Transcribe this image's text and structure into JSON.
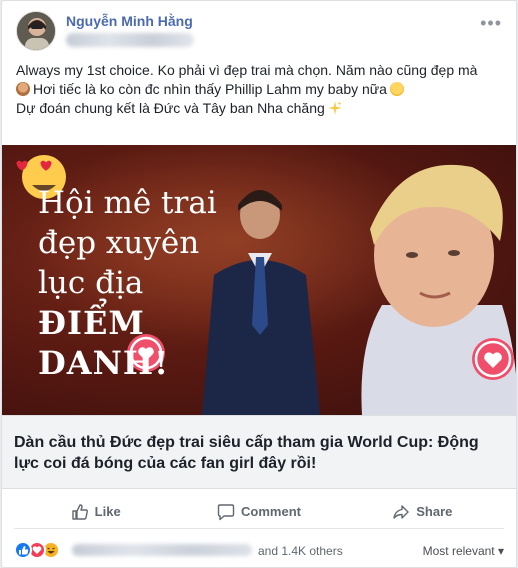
{
  "post": {
    "author": "Nguyễn Minh Hằng",
    "more_label": "•••",
    "lines": [
      "Always my 1st choice. Ko phải vì đẹp trai mà chọn. Năm nào cũng đẹp mà",
      "Hơi tiếc là ko còn đc nhìn thấy Phillip Lahm my baby nữa",
      "Dự đoán chung kết là Đức và Tây ban Nha chăng"
    ]
  },
  "media": {
    "headline": [
      "Hội mê trai",
      "đẹp xuyên",
      "lục địa",
      "ĐIỂM",
      "DANH!"
    ]
  },
  "link_card": {
    "title": "Dàn cầu thủ Đức đẹp trai siêu cấp tham gia World Cup: Động lực coi đá bóng của các fan girl đây rồi!"
  },
  "actions": {
    "like": "Like",
    "comment": "Comment",
    "share": "Share"
  },
  "footer": {
    "others": "and 1.4K others",
    "sort": "Most relevant ▾"
  },
  "colors": {
    "author": "#4b6aaf",
    "like_blue": "#1877f2",
    "love_red": "#f33e58",
    "haha_yellow": "#f7b125"
  }
}
